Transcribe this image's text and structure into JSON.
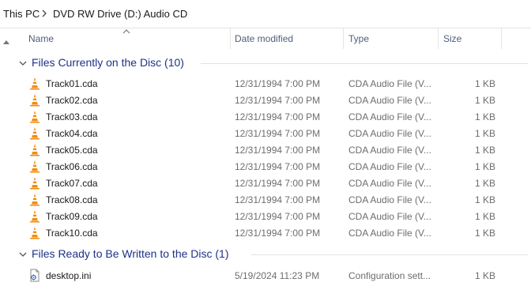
{
  "breadcrumb": {
    "items": [
      "This PC",
      "DVD RW Drive (D:) Audio CD"
    ]
  },
  "columns": {
    "name": "Name",
    "date_modified": "Date modified",
    "type": "Type",
    "size": "Size"
  },
  "groups": [
    {
      "label": "Files Currently on the Disc (10)",
      "files": [
        {
          "name": "Track01.cda",
          "date": "12/31/1994 7:00 PM",
          "type": "CDA Audio File (V...",
          "size": "1 KB",
          "icon": "vlc-cone-icon"
        },
        {
          "name": "Track02.cda",
          "date": "12/31/1994 7:00 PM",
          "type": "CDA Audio File (V...",
          "size": "1 KB",
          "icon": "vlc-cone-icon"
        },
        {
          "name": "Track03.cda",
          "date": "12/31/1994 7:00 PM",
          "type": "CDA Audio File (V...",
          "size": "1 KB",
          "icon": "vlc-cone-icon"
        },
        {
          "name": "Track04.cda",
          "date": "12/31/1994 7:00 PM",
          "type": "CDA Audio File (V...",
          "size": "1 KB",
          "icon": "vlc-cone-icon"
        },
        {
          "name": "Track05.cda",
          "date": "12/31/1994 7:00 PM",
          "type": "CDA Audio File (V...",
          "size": "1 KB",
          "icon": "vlc-cone-icon"
        },
        {
          "name": "Track06.cda",
          "date": "12/31/1994 7:00 PM",
          "type": "CDA Audio File (V...",
          "size": "1 KB",
          "icon": "vlc-cone-icon"
        },
        {
          "name": "Track07.cda",
          "date": "12/31/1994 7:00 PM",
          "type": "CDA Audio File (V...",
          "size": "1 KB",
          "icon": "vlc-cone-icon"
        },
        {
          "name": "Track08.cda",
          "date": "12/31/1994 7:00 PM",
          "type": "CDA Audio File (V...",
          "size": "1 KB",
          "icon": "vlc-cone-icon"
        },
        {
          "name": "Track09.cda",
          "date": "12/31/1994 7:00 PM",
          "type": "CDA Audio File (V...",
          "size": "1 KB",
          "icon": "vlc-cone-icon"
        },
        {
          "name": "Track10.cda",
          "date": "12/31/1994 7:00 PM",
          "type": "CDA Audio File (V...",
          "size": "1 KB",
          "icon": "vlc-cone-icon"
        }
      ]
    },
    {
      "label": "Files Ready to Be Written to the Disc (1)",
      "files": [
        {
          "name": "desktop.ini",
          "date": "5/19/2024 11:23 PM",
          "type": "Configuration sett...",
          "size": "1 KB",
          "icon": "settings-file-icon"
        }
      ]
    }
  ],
  "colors": {
    "group_heading": "#1e3287",
    "header_text": "#4c607a",
    "secondary_text": "#6d6d6d",
    "vlc_orange": "#f28c0f"
  }
}
